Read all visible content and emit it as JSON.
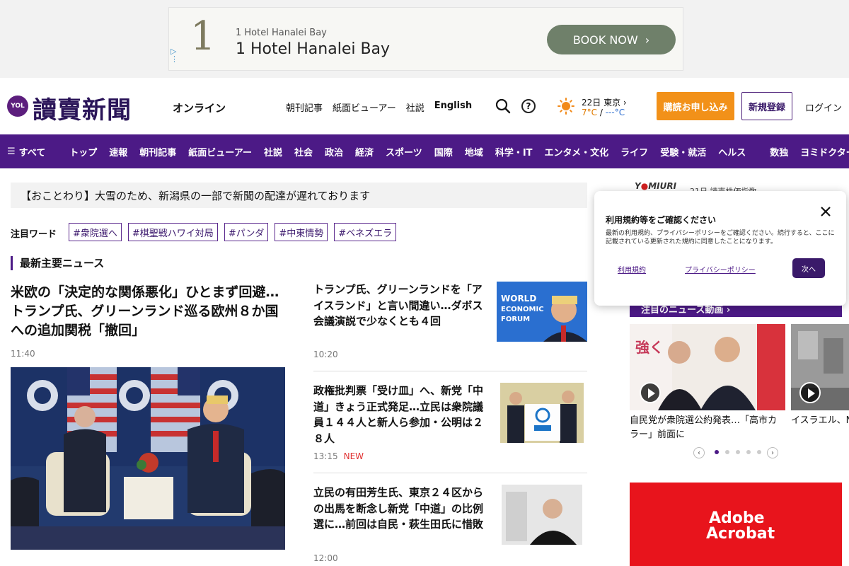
{
  "ad": {
    "logo_char": "1",
    "small_text": "1 Hotel Hanalei Bay",
    "big_text": "1 Hotel Hanalei Bay",
    "button_label": "BOOK NOW"
  },
  "header": {
    "logo_badge": "YOL",
    "logo_text": "讀賣新聞",
    "logo_sub": "オンライン",
    "links": [
      "朝刊記事",
      "紙面ビューアー",
      "社説",
      "English"
    ],
    "weather": {
      "date": "22日 東京",
      "high": "7°C",
      "sep": "/",
      "low": "---°C"
    },
    "subscribe_label": "購読お申し込み",
    "register_label": "新規登録",
    "login_label": "ログイン"
  },
  "nav": {
    "all_label": "すべて",
    "items": [
      "トップ",
      "速報",
      "朝刊記事",
      "紙面ビューアー",
      "社説",
      "社会",
      "政治",
      "経済",
      "スポーツ",
      "国際",
      "地域",
      "科学・IT",
      "エンタメ・文化",
      "ライフ",
      "受験・就活",
      "ヘルス"
    ],
    "extra": [
      "数独",
      "ヨミドクター"
    ]
  },
  "notice": "【おことわり】大雪のため、新潟県の一部で新聞の配達が遅れております",
  "trending": {
    "label": "注目ワード",
    "tags": [
      "#衆院選へ",
      "#棋聖戦ハワイ対局",
      "#パンダ",
      "#中東情勢",
      "#ベネズエラ"
    ]
  },
  "section_title": "最新主要ニュース",
  "lead": {
    "headline": "米欧の「決定的な関係悪化」ひとまず回避…トランプ氏、グリーンランド巡る欧州８か国への追加関税「撤回」",
    "time": "11:40"
  },
  "stories": [
    {
      "headline": "トランプ氏、グリーンランドを「アイスランド」と言い間違い…ダボス会議演説で少なくとも４回",
      "time": "10:20",
      "badge": ""
    },
    {
      "headline": "政権批判票「受け皿」へ、新党「中道」きょう正式発足…立民は衆院議員１４４人と新人ら参加・公明は２８人",
      "time": "13:15",
      "badge": "NEW"
    },
    {
      "headline": "立民の有田芳生氏、東京２４区からの出馬を断念し新党「中道」の比例選に…前回は自民・萩生田氏に惜敗",
      "time": "12:00",
      "badge": ""
    }
  ],
  "right": {
    "brand_prefix": "Y",
    "brand_rest": "MIURI",
    "line": "21日 読売株価指数",
    "video_bar": "注目のニュース動画",
    "videos": [
      {
        "caption": "自民党が衆院選公約発表…「高市カラー」前面に"
      },
      {
        "caption": "イスラエル、NRWA"
      }
    ],
    "ad_line1": "Adobe",
    "ad_line2": "Acrobat"
  },
  "consent": {
    "title": "利用規約等をご確認ください",
    "body": "最新の利用規約、プライバシーポリシーをご確認ください。続行すると、ここに記載されている更新された規約に同意したことになります。",
    "link1": "利用規約",
    "link2": "プライバシーポリシー",
    "next_label": "次へ"
  },
  "colors": {
    "brand_purple": "#4c1a86",
    "orange": "#f29119",
    "ad_red": "#e8141c"
  }
}
